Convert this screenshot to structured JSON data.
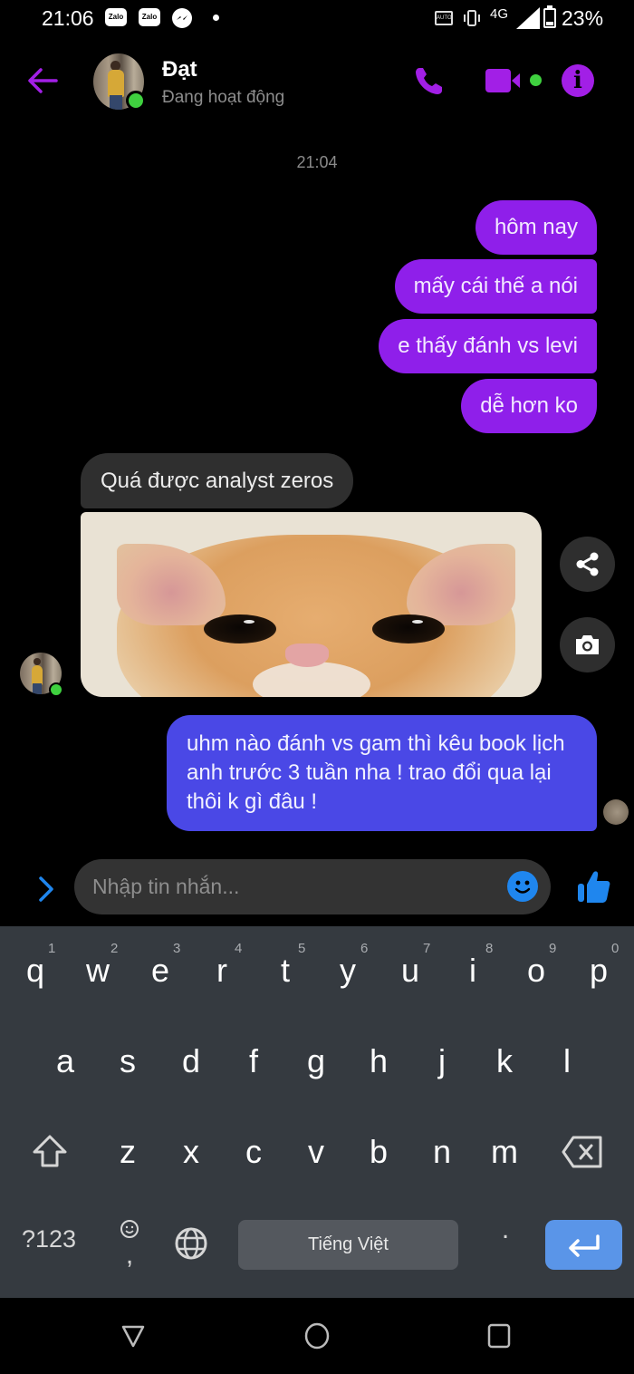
{
  "status_bar": {
    "time": "21:06",
    "notification_icons": [
      "zalo-icon",
      "zalo-icon",
      "messenger-icon",
      "dot-icon"
    ],
    "zalo_label": "Zalo",
    "network": "4G",
    "battery_percent": "23%",
    "battery_level": 0.23,
    "system_icons": [
      "auto-hz-icon",
      "vibrate-icon",
      "4g-icon",
      "signal-icon",
      "battery-icon"
    ]
  },
  "header": {
    "contact_name": "Đạt",
    "contact_status": "Đang hoạt động",
    "online": true,
    "actions": [
      "back-arrow-icon",
      "phone-icon",
      "video-camera-icon",
      "info-icon"
    ],
    "accent_color": "#a21fe6"
  },
  "conversation": {
    "timestamp": "21:04",
    "messages": [
      {
        "sender": "me",
        "text": "hôm nay"
      },
      {
        "sender": "me",
        "text": "mấy cái thế a nói"
      },
      {
        "sender": "me",
        "text": "e thấy đánh vs levi"
      },
      {
        "sender": "me",
        "text": "dễ hơn ko"
      },
      {
        "sender": "contact",
        "text": "Quá được analyst zeros"
      },
      {
        "sender": "contact",
        "type": "image",
        "description": "orange kitten close-up photo"
      },
      {
        "sender": "me",
        "text": "uhm nào đánh vs gam thì kêu book lịch anh trước 3 tuần nha ! trao đổi qua lại thôi k gì đâu !"
      }
    ],
    "image_actions": [
      "share-icon",
      "camera-icon"
    ],
    "outgoing_color": "#8f1fea",
    "outgoing_latest_color": "#4a48e6",
    "incoming_color": "#2f2f2f"
  },
  "composer": {
    "placeholder": "Nhập tin nhắn...",
    "value": "",
    "icons": [
      "chevron-right-icon",
      "emoji-icon",
      "thumbs-up-icon"
    ]
  },
  "keyboard": {
    "row1": [
      "q",
      "w",
      "e",
      "r",
      "t",
      "y",
      "u",
      "i",
      "o",
      "p"
    ],
    "row1_hints": [
      "1",
      "2",
      "3",
      "4",
      "5",
      "6",
      "7",
      "8",
      "9",
      "0"
    ],
    "row2": [
      "a",
      "s",
      "d",
      "f",
      "g",
      "h",
      "j",
      "k",
      "l"
    ],
    "row3": [
      "z",
      "x",
      "c",
      "v",
      "b",
      "n",
      "m"
    ],
    "symbols_label": "?123",
    "comma": ",",
    "space_label": "Tiếng Việt",
    "period": ".",
    "special_keys": [
      "shift-icon",
      "backspace-icon",
      "emoji-icon",
      "globe-icon",
      "enter-icon"
    ]
  },
  "nav_bar": {
    "buttons": [
      "back-triangle-icon",
      "home-circle-icon",
      "recents-square-icon"
    ]
  }
}
